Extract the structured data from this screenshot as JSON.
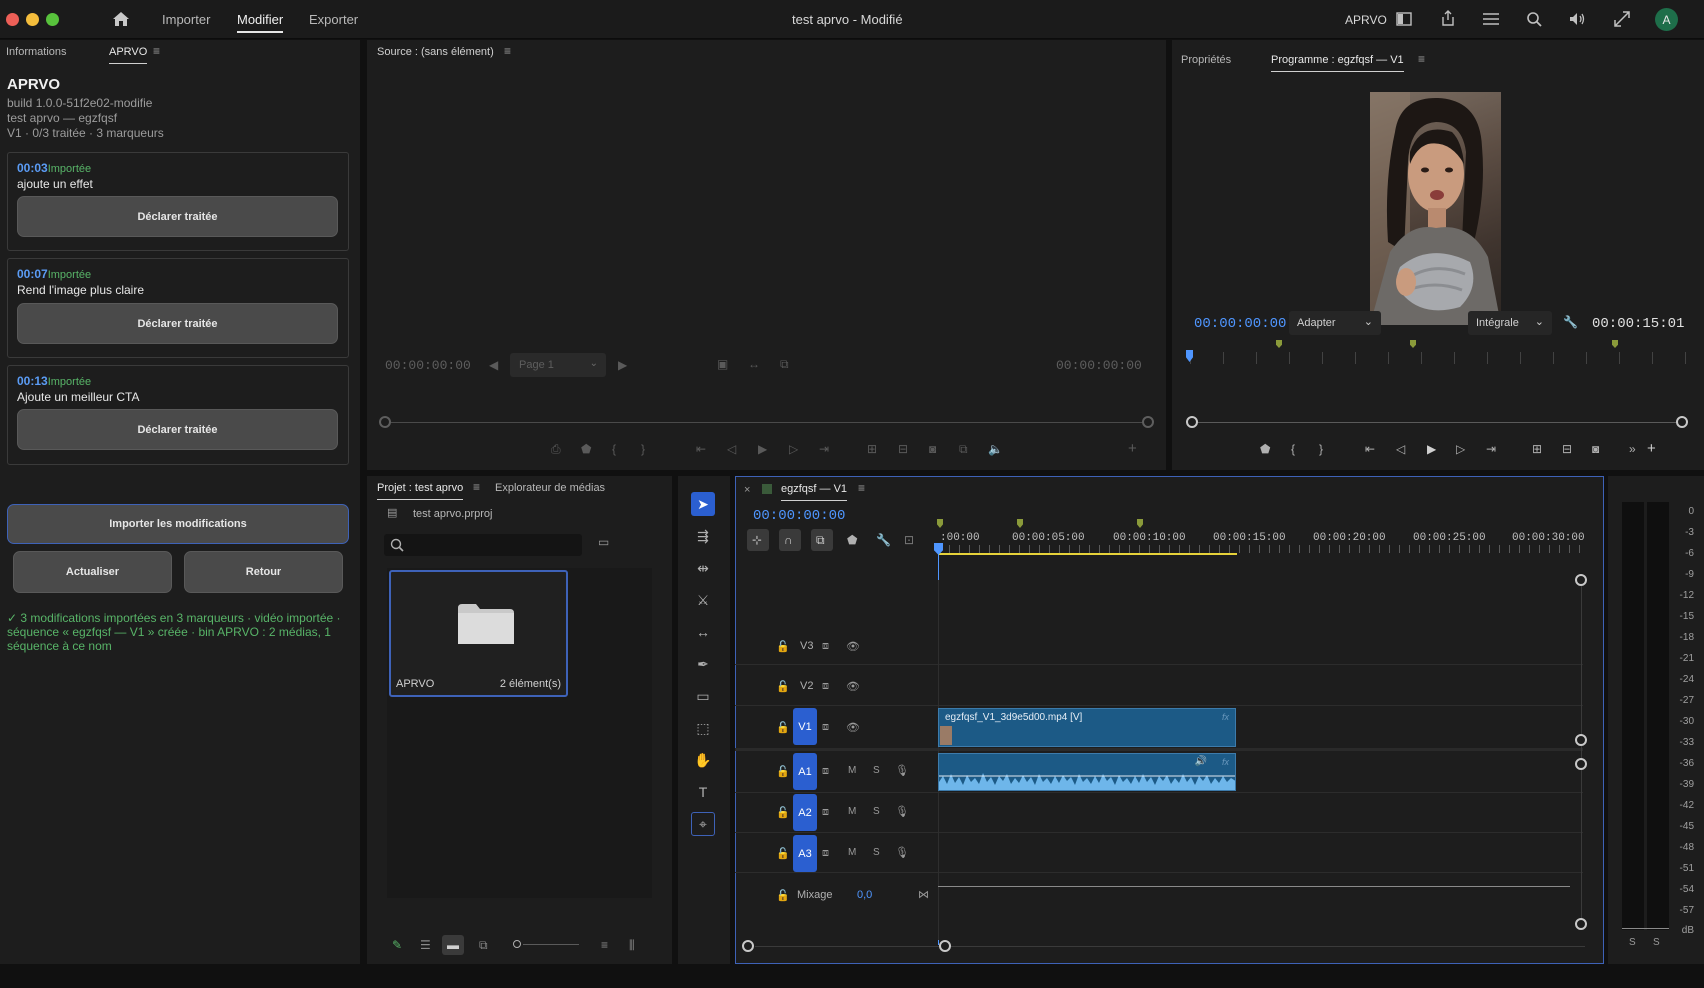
{
  "window": {
    "title": "test aprvo - Modifié",
    "nav": [
      "Importer",
      "Modifier",
      "Exporter"
    ],
    "active_nav": "Modifier",
    "workspace_label": "APRVO",
    "avatar_letter": "A"
  },
  "left_panel": {
    "tabs": [
      "Informations",
      "APRVO"
    ],
    "title": "APRVO",
    "build": "build 1.0.0-51f2e02-modifie",
    "project": "test aprvo — egzfqsf",
    "summary": "V1 · 0/3 traitée · 3 marqueurs",
    "notes": [
      {
        "time": "00:03",
        "status": "Importée",
        "text": "ajoute un effet",
        "button": "Déclarer traitée"
      },
      {
        "time": "00:07",
        "status": "Importée",
        "text": "Rend l'image plus claire",
        "button": "Déclarer traitée"
      },
      {
        "time": "00:13",
        "status": "Importée",
        "text": "Ajoute un meilleur CTA",
        "button": "Déclarer traitée"
      }
    ],
    "import_button": "Importer les modifications",
    "refresh_button": "Actualiser",
    "back_button": "Retour",
    "status_message": "✓ 3 modifications importées en 3 marqueurs · vidéo importée · séquence « egzfqsf — V1 » créée · bin APRVO : 2 médias, 1 séquence à ce nom"
  },
  "source_monitor": {
    "tab": "Source : (sans élément)",
    "timecode_left": "00:00:00:00",
    "timecode_right": "00:00:00:00",
    "page_select": "Page 1"
  },
  "program_monitor": {
    "tabs": [
      "Propriétés",
      "Programme : egzfqsf — V1"
    ],
    "timecode": "00:00:00:00",
    "fit_select": "Adapter",
    "quality_select": "Intégrale",
    "duration": "00:00:15:01"
  },
  "project_panel": {
    "tabs": [
      "Projet : test aprvo",
      "Explorateur de médias"
    ],
    "file": "test aprvo.prproj",
    "search_placeholder": "",
    "bin": {
      "name": "APRVO",
      "count": "2 élément(s)"
    }
  },
  "timeline": {
    "sequence_tab": "egzfqsf — V1",
    "timecode": "00:00:00:00",
    "ruler_labels": [
      ":00:00",
      "00:00:05:00",
      "00:00:10:00",
      "00:00:15:00",
      "00:00:20:00",
      "00:00:25:00",
      "00:00:30:00"
    ],
    "tracks": {
      "video": [
        "V3",
        "V2",
        "V1"
      ],
      "audio": [
        "A1",
        "A2",
        "A3"
      ],
      "mute_label": "M",
      "solo_label": "S",
      "mix_label": "Mixage",
      "mix_value": "0,0"
    },
    "clip_label": "egzfqsf_V1_3d9e5d00.mp4 [V]",
    "clip_fx": "fx"
  },
  "audio_meter": {
    "labels": [
      "0",
      "-3",
      "-6",
      "-9",
      "-12",
      "-15",
      "-18",
      "-21",
      "-24",
      "-27",
      "-30",
      "-33",
      "-36",
      "-39",
      "-42",
      "-45",
      "-48",
      "-51",
      "-54",
      "-57",
      "dB"
    ],
    "solo_labels": [
      "S",
      "S"
    ]
  },
  "colors": {
    "accent_blue": "#4f96ff",
    "track_blue": "#2b5fd0",
    "clip_blue": "#1c5a86",
    "status_green": "#58b468",
    "marker_green": "#8a9a3a"
  }
}
